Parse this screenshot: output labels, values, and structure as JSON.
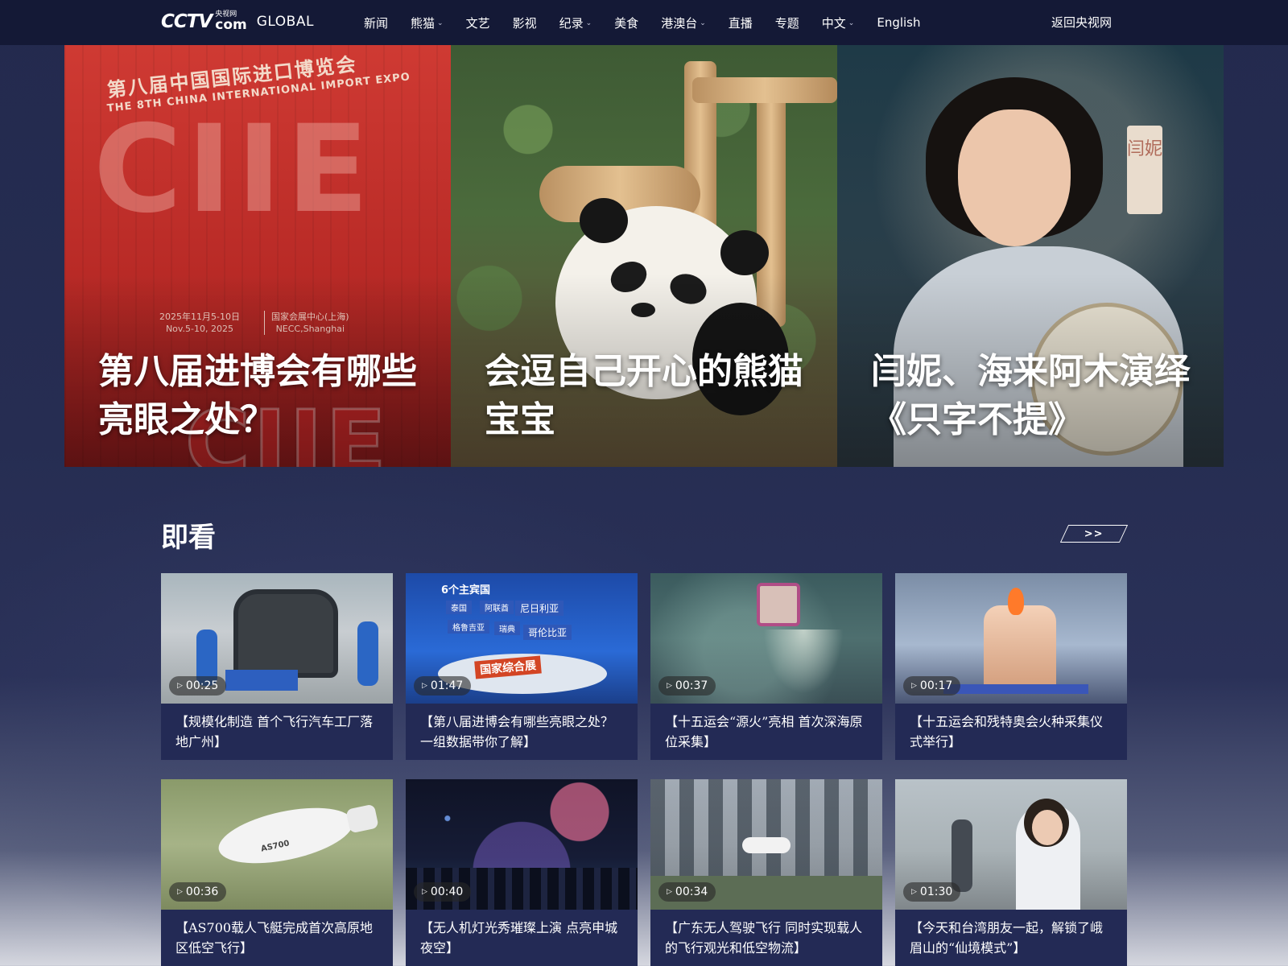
{
  "header": {
    "logo_mark": "CCTV",
    "logo_cn": "央视网",
    "logo_com": "com",
    "logo_global": "GLOBAL",
    "nav": [
      {
        "label": "新闻",
        "dropdown": false
      },
      {
        "label": "熊猫",
        "dropdown": true
      },
      {
        "label": "文艺",
        "dropdown": false
      },
      {
        "label": "影视",
        "dropdown": false
      },
      {
        "label": "纪录",
        "dropdown": true
      },
      {
        "label": "美食",
        "dropdown": false
      },
      {
        "label": "港澳台",
        "dropdown": true
      },
      {
        "label": "直播",
        "dropdown": false
      },
      {
        "label": "专题",
        "dropdown": false
      },
      {
        "label": "中文",
        "dropdown": true
      },
      {
        "label": "English",
        "dropdown": false
      }
    ],
    "back_link": "返回央视网"
  },
  "hero": [
    {
      "title": "第八届进博会有哪些亮眼之处？",
      "image": {
        "headline_cn": "第八届中国国际进口博览会",
        "headline_en": "THE 8TH CHINA INTERNATIONAL IMPORT EXPO",
        "big_mark": "CIIE",
        "date_cn": "2025年11月5-10日",
        "date_en": "Nov.5-10, 2025",
        "venue_cn": "国家会展中心(上海)",
        "venue_en": "NECC,Shanghai"
      }
    },
    {
      "title": "会逗自己开心的熊猫宝宝"
    },
    {
      "title": "闫妮、海来阿木演绎《只字不提》",
      "image": {
        "sign_text": "闫妮"
      }
    }
  ],
  "section": {
    "title": "即看",
    "more_label": ">>"
  },
  "videos": [
    {
      "duration": "00:25",
      "caption": "【规模化制造 首个飞行汽车工厂落地广州】"
    },
    {
      "duration": "01:47",
      "caption": "【第八届进博会有哪些亮眼之处？一组数据带你了解】",
      "thumb_text": [
        "6个主宾国",
        "泰国",
        "阿联酋",
        "尼日利亚",
        "格鲁吉亚",
        "瑞典",
        "哥伦比亚",
        "国家综合展"
      ]
    },
    {
      "duration": "00:37",
      "caption": "【十五运会“源火”亮相 首次深海原位采集】"
    },
    {
      "duration": "00:17",
      "caption": "【十五运会和残特奥会火种采集仪式举行】"
    },
    {
      "duration": "00:36",
      "caption": "【AS700载人飞艇完成首次高原地区低空飞行】",
      "thumb_text": [
        "AS700"
      ]
    },
    {
      "duration": "00:40",
      "caption": "【无人机灯光秀璀璨上演 点亮申城夜空】"
    },
    {
      "duration": "00:34",
      "caption": "【广东无人驾驶飞行 同时实现载人的飞行观光和低空物流】"
    },
    {
      "duration": "01:30",
      "caption": "【今天和台湾朋友一起，解锁了峨眉山的“仙境模式”】"
    }
  ]
}
